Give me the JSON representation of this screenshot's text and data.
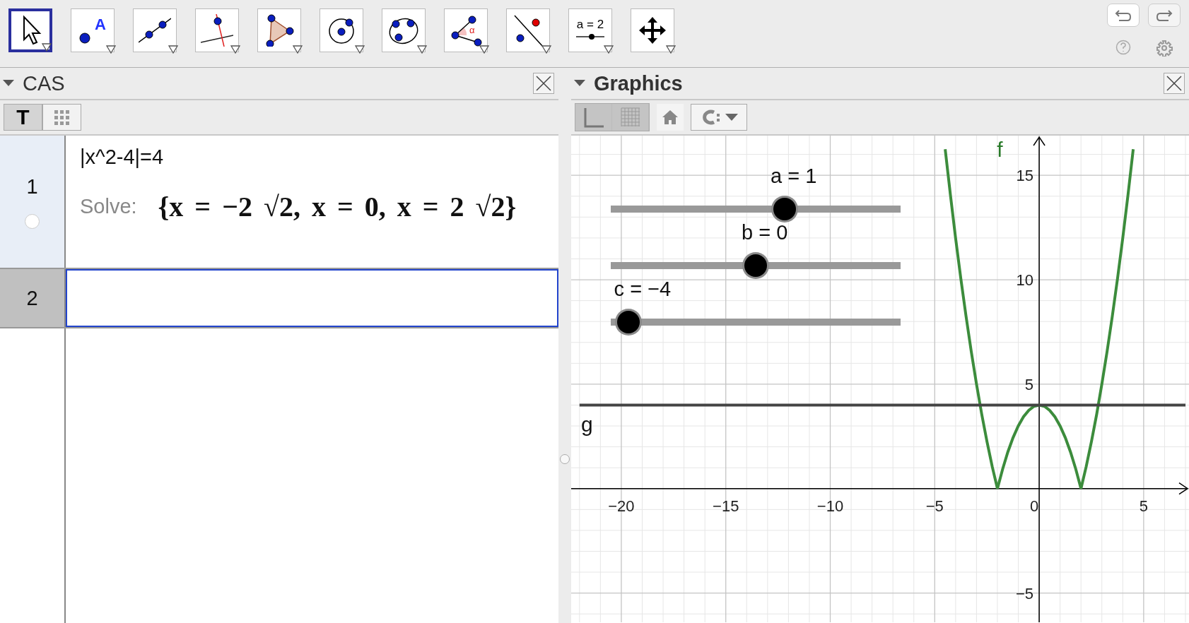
{
  "toolbar": {
    "tools": [
      {
        "kind": "move",
        "selected": true
      },
      {
        "kind": "point",
        "selected": false,
        "label": "A"
      },
      {
        "kind": "line",
        "selected": false
      },
      {
        "kind": "perpendicular",
        "selected": false
      },
      {
        "kind": "polygon",
        "selected": false
      },
      {
        "kind": "circle",
        "selected": false
      },
      {
        "kind": "conic",
        "selected": false
      },
      {
        "kind": "angle",
        "selected": false,
        "label": "α"
      },
      {
        "kind": "reflect",
        "selected": false
      },
      {
        "kind": "slider",
        "selected": false,
        "label": "a = 2"
      },
      {
        "kind": "move-view",
        "selected": false
      }
    ]
  },
  "cas": {
    "title": "CAS",
    "style_buttons": [
      {
        "kind": "text",
        "label": "T"
      },
      {
        "kind": "table"
      }
    ],
    "rows": [
      {
        "number": "1",
        "selected": false,
        "input": "|x^2-4|=4",
        "output_label": "Solve:",
        "output": "{x = −2 √2, x = 0, x = 2 √2}"
      },
      {
        "number": "2",
        "selected": true,
        "input": ""
      }
    ]
  },
  "graphics": {
    "title": "Graphics",
    "toggles": [
      {
        "kind": "axes",
        "on": true
      },
      {
        "kind": "grid",
        "on": true
      }
    ],
    "sliders": [
      {
        "label": "a = 1",
        "level": 0.6
      },
      {
        "label": "b = 0",
        "level": 0.5
      },
      {
        "label": "c = −4",
        "level": 0.06
      }
    ],
    "chart_data": {
      "type": "line",
      "x": [
        -22,
        -4.5,
        -4.25,
        -4,
        -3.75,
        -3.5,
        -3.25,
        -3,
        -2.75,
        -2.5,
        -2.25,
        -2,
        -1.75,
        -1.5,
        -1.25,
        -1,
        -0.75,
        -0.5,
        -0.25,
        0,
        0.25,
        0.5,
        0.75,
        1,
        1.25,
        1.5,
        1.75,
        2,
        2.25,
        2.5,
        2.75,
        3,
        3.25,
        3.5,
        3.75,
        4,
        4.25,
        4.5,
        7
      ],
      "series": [
        {
          "name": "f",
          "color": "#3c8c3c",
          "values": [
            null,
            16.25,
            14.06,
            12,
            10.06,
            8.25,
            6.56,
            5,
            3.56,
            2.25,
            1.06,
            0,
            0.94,
            1.75,
            2.44,
            3,
            3.44,
            3.75,
            3.94,
            4,
            3.94,
            3.75,
            3.44,
            3,
            2.44,
            1.75,
            0.94,
            0,
            1.06,
            2.25,
            3.56,
            5,
            6.56,
            8.25,
            10.06,
            12,
            14.06,
            16.25,
            null
          ]
        },
        {
          "name": "g",
          "color": "#444444",
          "values": [
            4,
            4,
            4,
            4,
            4,
            4,
            4,
            4,
            4,
            4,
            4,
            4,
            4,
            4,
            4,
            4,
            4,
            4,
            4,
            4,
            4,
            4,
            4,
            4,
            4,
            4,
            4,
            4,
            4,
            4,
            4,
            4,
            4,
            4,
            4,
            4,
            4,
            4,
            4
          ]
        }
      ],
      "xlim": [
        -22.4,
        7.17
      ],
      "ylim": [
        -6.4,
        16.9
      ],
      "xticks": [
        {
          "value": -20,
          "label": "−20"
        },
        {
          "value": -15,
          "label": "−15"
        },
        {
          "value": -10,
          "label": "−10"
        },
        {
          "value": -5,
          "label": "−5"
        },
        {
          "value": 0,
          "label": "0"
        },
        {
          "value": 5,
          "label": "5"
        }
      ],
      "grid": true,
      "yticks": [
        {
          "value": -5,
          "label": "−5"
        },
        {
          "value": 5,
          "label": "5"
        },
        {
          "value": 10,
          "label": "10"
        },
        {
          "value": 15,
          "label": "15"
        }
      ]
    }
  }
}
